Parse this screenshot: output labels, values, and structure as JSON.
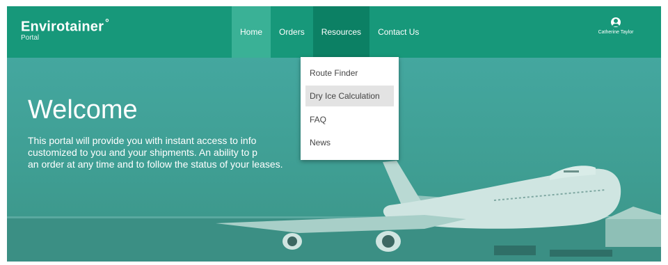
{
  "brand": {
    "name": "Envirotainer",
    "mark": "°",
    "subtitle": "Portal"
  },
  "nav": {
    "items": [
      {
        "label": "Home",
        "id": "home"
      },
      {
        "label": "Orders",
        "id": "orders"
      },
      {
        "label": "Resources",
        "id": "resources"
      },
      {
        "label": "Contact Us",
        "id": "contact-us"
      }
    ],
    "active": "Home",
    "open": "Resources"
  },
  "user": {
    "name": "Catherine Taylor",
    "icon": "user-circle-icon"
  },
  "dropdown": {
    "items": [
      {
        "label": "Route Finder"
      },
      {
        "label": "Dry Ice Calculation"
      },
      {
        "label": "FAQ"
      },
      {
        "label": "News"
      }
    ],
    "hovered": "Dry Ice Calculation"
  },
  "hero": {
    "title": "Welcome",
    "lines": [
      "This portal will provide you with instant access to info",
      "customized to you and your shipments. An ability to p",
      "an order at any time and to follow the status of your leases."
    ]
  },
  "colors": {
    "header": "#17987a",
    "nav_active": "#3ab196",
    "nav_open": "#0c8064",
    "hero": "#42a297",
    "dropdown_hover": "#e3e3e3"
  }
}
